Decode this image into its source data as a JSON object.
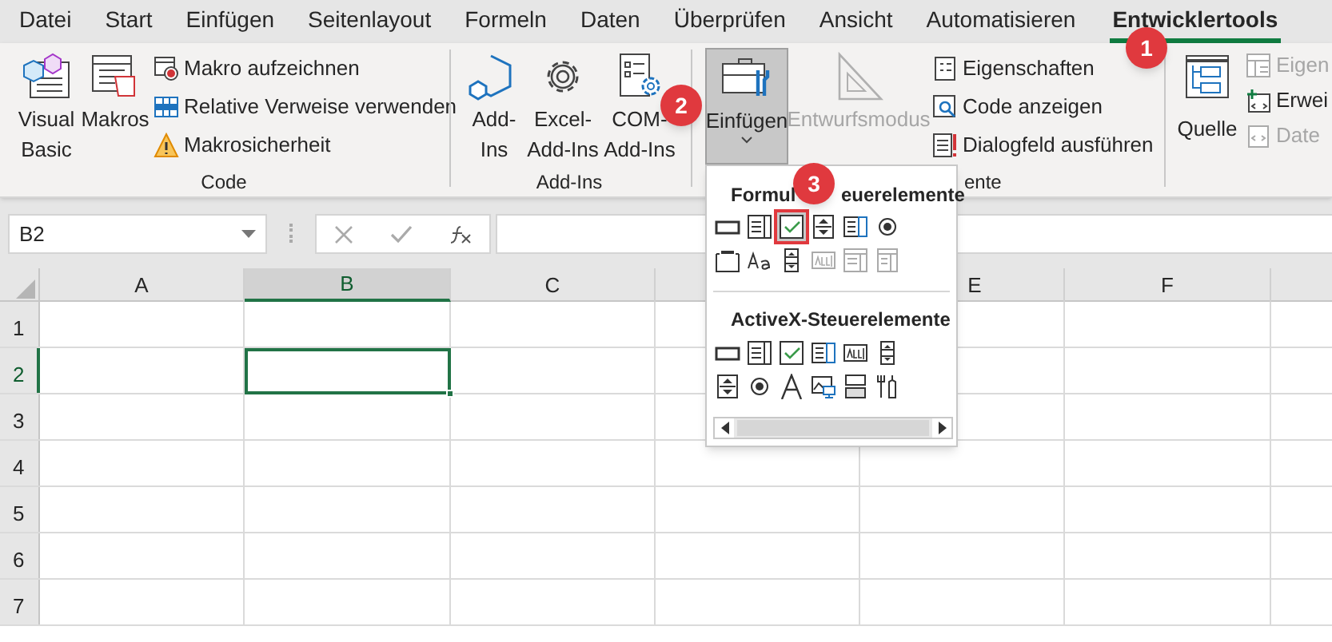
{
  "tabs": [
    {
      "label": "Datei",
      "selected": false
    },
    {
      "label": "Start",
      "selected": false
    },
    {
      "label": "Einfügen",
      "selected": false
    },
    {
      "label": "Seitenlayout",
      "selected": false
    },
    {
      "label": "Formeln",
      "selected": false
    },
    {
      "label": "Daten",
      "selected": false
    },
    {
      "label": "Überprüfen",
      "selected": false
    },
    {
      "label": "Ansicht",
      "selected": false
    },
    {
      "label": "Automatisieren",
      "selected": false
    },
    {
      "label": "Entwicklertools",
      "selected": true
    }
  ],
  "ribbon": {
    "code": {
      "label": "Code",
      "large": [
        {
          "kind": "vba",
          "label": "Visual\nBasic"
        },
        {
          "kind": "macros",
          "label": "Makros"
        }
      ],
      "small": [
        {
          "kind": "record",
          "label": "Makro aufzeichnen"
        },
        {
          "kind": "relative",
          "label": "Relative Verweise verwenden"
        },
        {
          "kind": "warning",
          "label": "Makrosicherheit"
        }
      ]
    },
    "addins": {
      "label": "Add-Ins",
      "large": [
        {
          "kind": "hexagon",
          "label": "Add-\nIns"
        },
        {
          "kind": "gear",
          "label": "Excel-\nAdd-Ins"
        },
        {
          "kind": "comgear",
          "label": "COM-\nAdd-Ins"
        }
      ]
    },
    "controls": {
      "label": "ente",
      "insert": {
        "label": "Einfügen",
        "pressed": true
      },
      "design_mode": {
        "label": "Entwurfsmodus",
        "disabled": true
      },
      "small": [
        {
          "kind": "properties",
          "label": "Eigenschaften"
        },
        {
          "kind": "viewcode",
          "label": "Code anzeigen"
        },
        {
          "kind": "dialog",
          "label": "Dialogfeld ausführen"
        }
      ]
    },
    "xml": {
      "source": {
        "label": "Quelle"
      },
      "small": [
        {
          "kind": "mapprops",
          "label": "Eigen",
          "disabled": true
        },
        {
          "kind": "expansion",
          "label": "Erwei",
          "disabled": false
        },
        {
          "kind": "refresh",
          "label": "Date",
          "disabled": true
        }
      ]
    }
  },
  "formula_bar": {
    "name_box": "B2"
  },
  "sheet": {
    "columns": [
      {
        "label": "A",
        "selected": false
      },
      {
        "label": "B",
        "selected": true
      },
      {
        "label": "C",
        "selected": false
      },
      {
        "label": "E",
        "selected": false
      },
      {
        "label": "F",
        "selected": false
      }
    ],
    "rows": [
      {
        "label": "1",
        "selected": false
      },
      {
        "label": "2",
        "selected": true
      },
      {
        "label": "3",
        "selected": false
      },
      {
        "label": "4",
        "selected": false
      },
      {
        "label": "5",
        "selected": false
      },
      {
        "label": "6",
        "selected": false
      },
      {
        "label": "7",
        "selected": false
      }
    ]
  },
  "insert_menu": {
    "form_title_parts": [
      "Formul",
      "euerelemente"
    ],
    "form_controls": [
      {
        "kind": "button",
        "disabled": false,
        "selected": false
      },
      {
        "kind": "combo",
        "disabled": false,
        "selected": false
      },
      {
        "kind": "checkbox",
        "disabled": false,
        "selected": true
      },
      {
        "kind": "spin",
        "disabled": false,
        "selected": false
      },
      {
        "kind": "listbox",
        "disabled": false,
        "selected": false
      },
      {
        "kind": "radio",
        "disabled": false,
        "selected": false
      },
      {
        "kind": "groupbox",
        "disabled": false,
        "selected": false
      },
      {
        "kind": "label",
        "disabled": false,
        "selected": false
      },
      {
        "kind": "scrollbar",
        "disabled": false,
        "selected": false
      },
      {
        "kind": "textfield",
        "disabled": true,
        "selected": false
      },
      {
        "kind": "combolist",
        "disabled": true,
        "selected": false
      },
      {
        "kind": "combodrop",
        "disabled": true,
        "selected": false
      }
    ],
    "activex_title": "ActiveX-Steuerelemente",
    "activex_controls": [
      {
        "kind": "button"
      },
      {
        "kind": "combo"
      },
      {
        "kind": "checkbox"
      },
      {
        "kind": "listbox"
      },
      {
        "kind": "textfield"
      },
      {
        "kind": "scrollbar"
      },
      {
        "kind": "spin"
      },
      {
        "kind": "radio"
      },
      {
        "kind": "biglabel"
      },
      {
        "kind": "image"
      },
      {
        "kind": "toggle"
      },
      {
        "kind": "more"
      }
    ]
  },
  "badges": [
    {
      "label": "1"
    },
    {
      "label": "2"
    },
    {
      "label": "3"
    }
  ]
}
